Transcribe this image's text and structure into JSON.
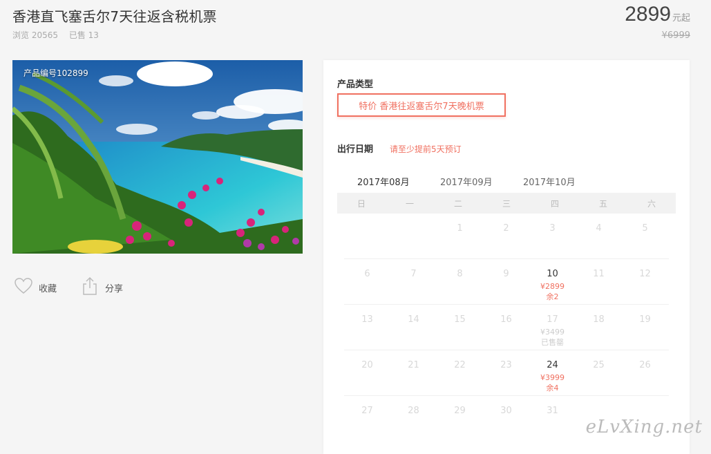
{
  "title": "香港直飞塞舌尔7天往返含税机票",
  "stats": {
    "views": "浏览 20565",
    "sold": "已售 13"
  },
  "price": {
    "main": "2899",
    "unit": "元起",
    "original": "¥6999"
  },
  "hero": {
    "code": "产品编号102899"
  },
  "actions": {
    "favorite": "收藏",
    "share": "分享"
  },
  "panel": {
    "type_label": "产品类型",
    "type_option": "特价 香港往返塞舌尔7天晚机票",
    "date_label": "出行日期",
    "date_hint": "请至少提前5天预订"
  },
  "tabs": [
    "2017年08月",
    "2017年09月",
    "2017年10月"
  ],
  "weekdays": [
    "日",
    "一",
    "二",
    "三",
    "四",
    "五",
    "六"
  ],
  "calendar": [
    [
      {
        "d": ""
      },
      {
        "d": ""
      },
      {
        "d": "1"
      },
      {
        "d": "2"
      },
      {
        "d": "3"
      },
      {
        "d": "4"
      },
      {
        "d": "5"
      }
    ],
    [
      {
        "d": "6"
      },
      {
        "d": "7"
      },
      {
        "d": "8"
      },
      {
        "d": "9"
      },
      {
        "d": "10",
        "p": "¥2899",
        "r": "余2",
        "s": "avail"
      },
      {
        "d": "11"
      },
      {
        "d": "12"
      }
    ],
    [
      {
        "d": "13"
      },
      {
        "d": "14"
      },
      {
        "d": "15"
      },
      {
        "d": "16"
      },
      {
        "d": "17",
        "p": "¥3499",
        "r": "已售罄",
        "s": "sold"
      },
      {
        "d": "18"
      },
      {
        "d": "19"
      }
    ],
    [
      {
        "d": "20"
      },
      {
        "d": "21"
      },
      {
        "d": "22"
      },
      {
        "d": "23"
      },
      {
        "d": "24",
        "p": "¥3999",
        "r": "余4",
        "s": "avail"
      },
      {
        "d": "25"
      },
      {
        "d": "26"
      }
    ],
    [
      {
        "d": "27"
      },
      {
        "d": "28"
      },
      {
        "d": "29"
      },
      {
        "d": "30"
      },
      {
        "d": "31"
      },
      {
        "d": ""
      },
      {
        "d": ""
      }
    ]
  ],
  "watermark": "eLvXing.net",
  "colors": {
    "accent": "#f07060"
  },
  "icons": {
    "favorite": "heart-icon",
    "share": "share-icon"
  }
}
